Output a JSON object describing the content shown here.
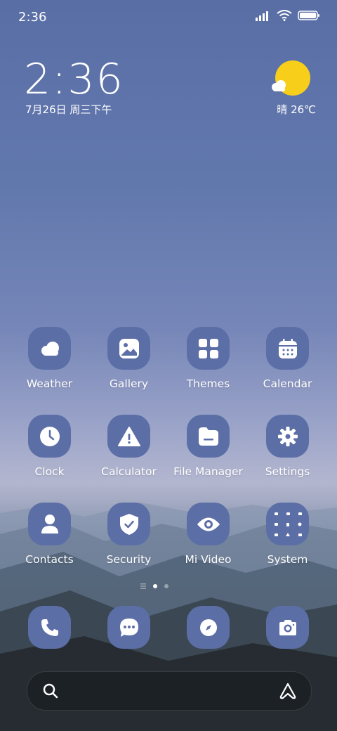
{
  "status_bar": {
    "time": "2:36"
  },
  "clock_widget": {
    "time": "2:36",
    "date": "7月26日 周三下午"
  },
  "weather_widget": {
    "condition": "晴",
    "temperature": "26℃"
  },
  "apps": [
    {
      "label": "Weather",
      "icon": "weather-icon"
    },
    {
      "label": "Gallery",
      "icon": "gallery-icon"
    },
    {
      "label": "Themes",
      "icon": "themes-icon"
    },
    {
      "label": "Calendar",
      "icon": "calendar-icon"
    },
    {
      "label": "Clock",
      "icon": "clock-icon"
    },
    {
      "label": "Calculator",
      "icon": "calculator-icon"
    },
    {
      "label": "File Manager",
      "icon": "file-manager-icon"
    },
    {
      "label": "Settings",
      "icon": "settings-icon"
    },
    {
      "label": "Contacts",
      "icon": "contacts-icon"
    },
    {
      "label": "Security",
      "icon": "security-icon"
    },
    {
      "label": "Mi Video",
      "icon": "mi-video-icon"
    },
    {
      "label": "System",
      "icon": "system-folder-icon"
    }
  ],
  "pager": {
    "pages": 2,
    "active_page": 1
  },
  "dock": [
    {
      "icon": "phone-icon"
    },
    {
      "icon": "messages-icon"
    },
    {
      "icon": "browser-icon"
    },
    {
      "icon": "camera-icon"
    }
  ],
  "colors": {
    "icon_background": "#5c6ea6",
    "sun": "#f7cf1b"
  }
}
